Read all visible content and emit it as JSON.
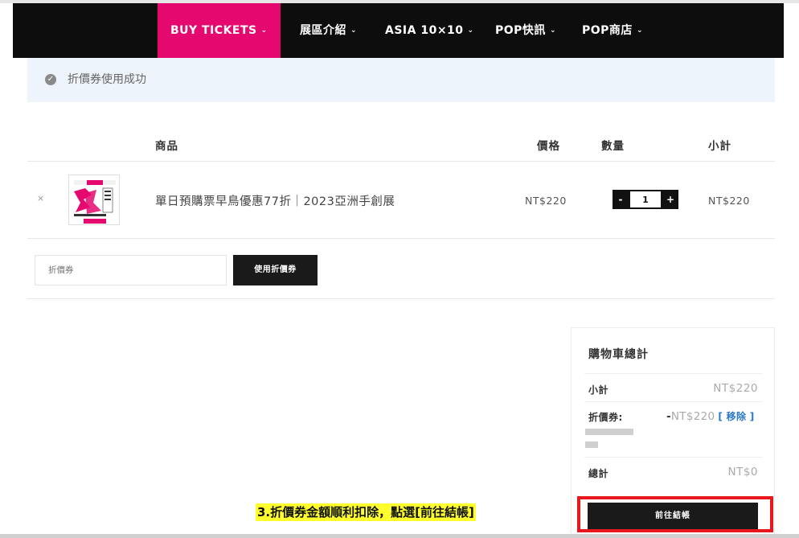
{
  "nav": {
    "items": [
      {
        "label": "BUY TICKETS",
        "active": true
      },
      {
        "label": "展區介紹"
      },
      {
        "label": "ASIA 10×10"
      },
      {
        "label": "POP快訊"
      },
      {
        "label": "POP商店"
      }
    ],
    "chevron": "⌄"
  },
  "notice": {
    "text": "折價券使用成功",
    "icon": "check-circle-icon"
  },
  "table": {
    "headers": {
      "product": "商品",
      "price": "價格",
      "quantity": "數量",
      "subtotal": "小計"
    },
    "rows": [
      {
        "remove": "×",
        "name": "單日預購票早鳥優惠77折｜2023亞洲手創展",
        "price": "NT$220",
        "quantity": "1",
        "subtotal": "NT$220"
      }
    ]
  },
  "qty": {
    "minus": "-",
    "plus": "+"
  },
  "coupon": {
    "placeholder": "折價券",
    "button_label": "使用折價券"
  },
  "totals": {
    "title": "購物車總計",
    "subtotal_label": "小計",
    "subtotal_value": "NT$220",
    "coupon_label": "折價券:",
    "coupon_dash": "-",
    "coupon_value": "NT$220",
    "coupon_remove": "[ 移除 ]",
    "total_label": "總計",
    "total_value": "NT$0",
    "checkout_label": "前往結帳"
  },
  "annotation": {
    "text": "3.折價券金額順利扣除，點選[前往結帳]"
  },
  "colors": {
    "accent": "#e5086e",
    "highlight": "#e8161d",
    "link": "#2a79c8"
  }
}
